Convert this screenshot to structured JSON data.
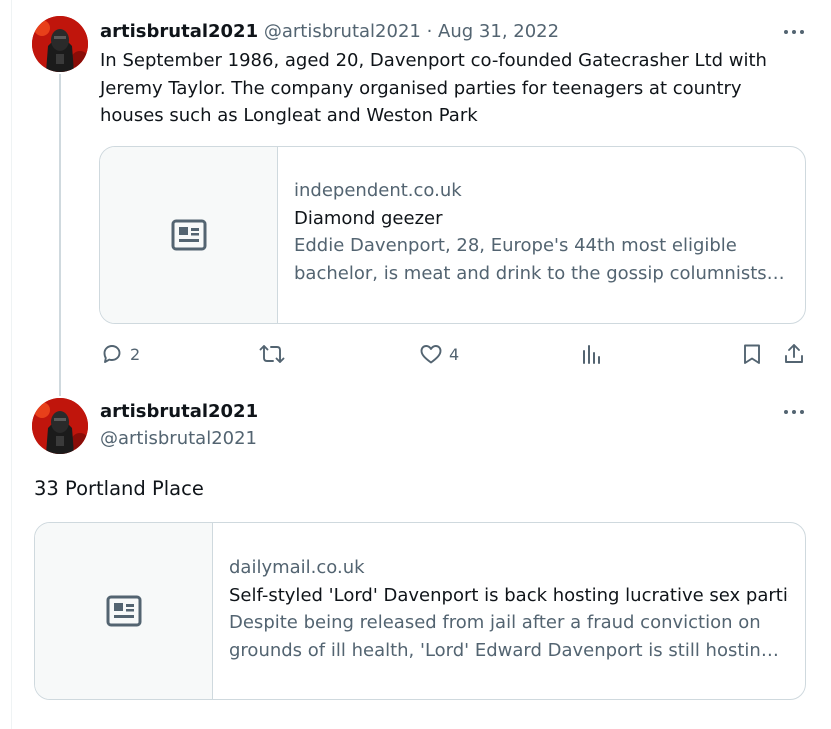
{
  "tweets": [
    {
      "display_name": "artisbrutal2021",
      "handle": "@artisbrutal2021",
      "separator": "·",
      "date": "Aug 31, 2022",
      "text": "In September 1986, aged 20, Davenport co-founded Gatecrasher Ltd with Jeremy Taylor. The company organised parties for teenagers at country houses such as Longleat and Weston Park",
      "card": {
        "domain": "independent.co.uk",
        "title": "Diamond geezer",
        "description": "Eddie Davenport, 28, Europe's 44th most eligible bachelor, is meat and drink to the gossip columnists, which is probably why he loves them so much"
      },
      "actions": {
        "replies": "2",
        "retweets": "",
        "likes": "4",
        "views": ""
      }
    },
    {
      "display_name": "artisbrutal2021",
      "handle": "@artisbrutal2021",
      "text": "33 Portland Place",
      "card": {
        "domain": "dailymail.co.uk",
        "title": "Self-styled 'Lord' Davenport is back hosting lucrative sex parties",
        "description": "Despite being released from jail after a fraud conviction on grounds of ill health, 'Lord' Edward Davenport is still hosting parties"
      }
    }
  ],
  "icons": {
    "more": "more-horizontal-icon",
    "reply": "reply-icon",
    "retweet": "retweet-icon",
    "like": "heart-icon",
    "views": "views-icon",
    "bookmark": "bookmark-icon",
    "share": "share-icon",
    "card_thumb": "article-icon"
  },
  "colors": {
    "text_primary": "#0f1419",
    "text_secondary": "#536471",
    "border": "#cfd9de",
    "thumb_bg": "#f7f9f9",
    "avatar_red": "#c0150c"
  }
}
